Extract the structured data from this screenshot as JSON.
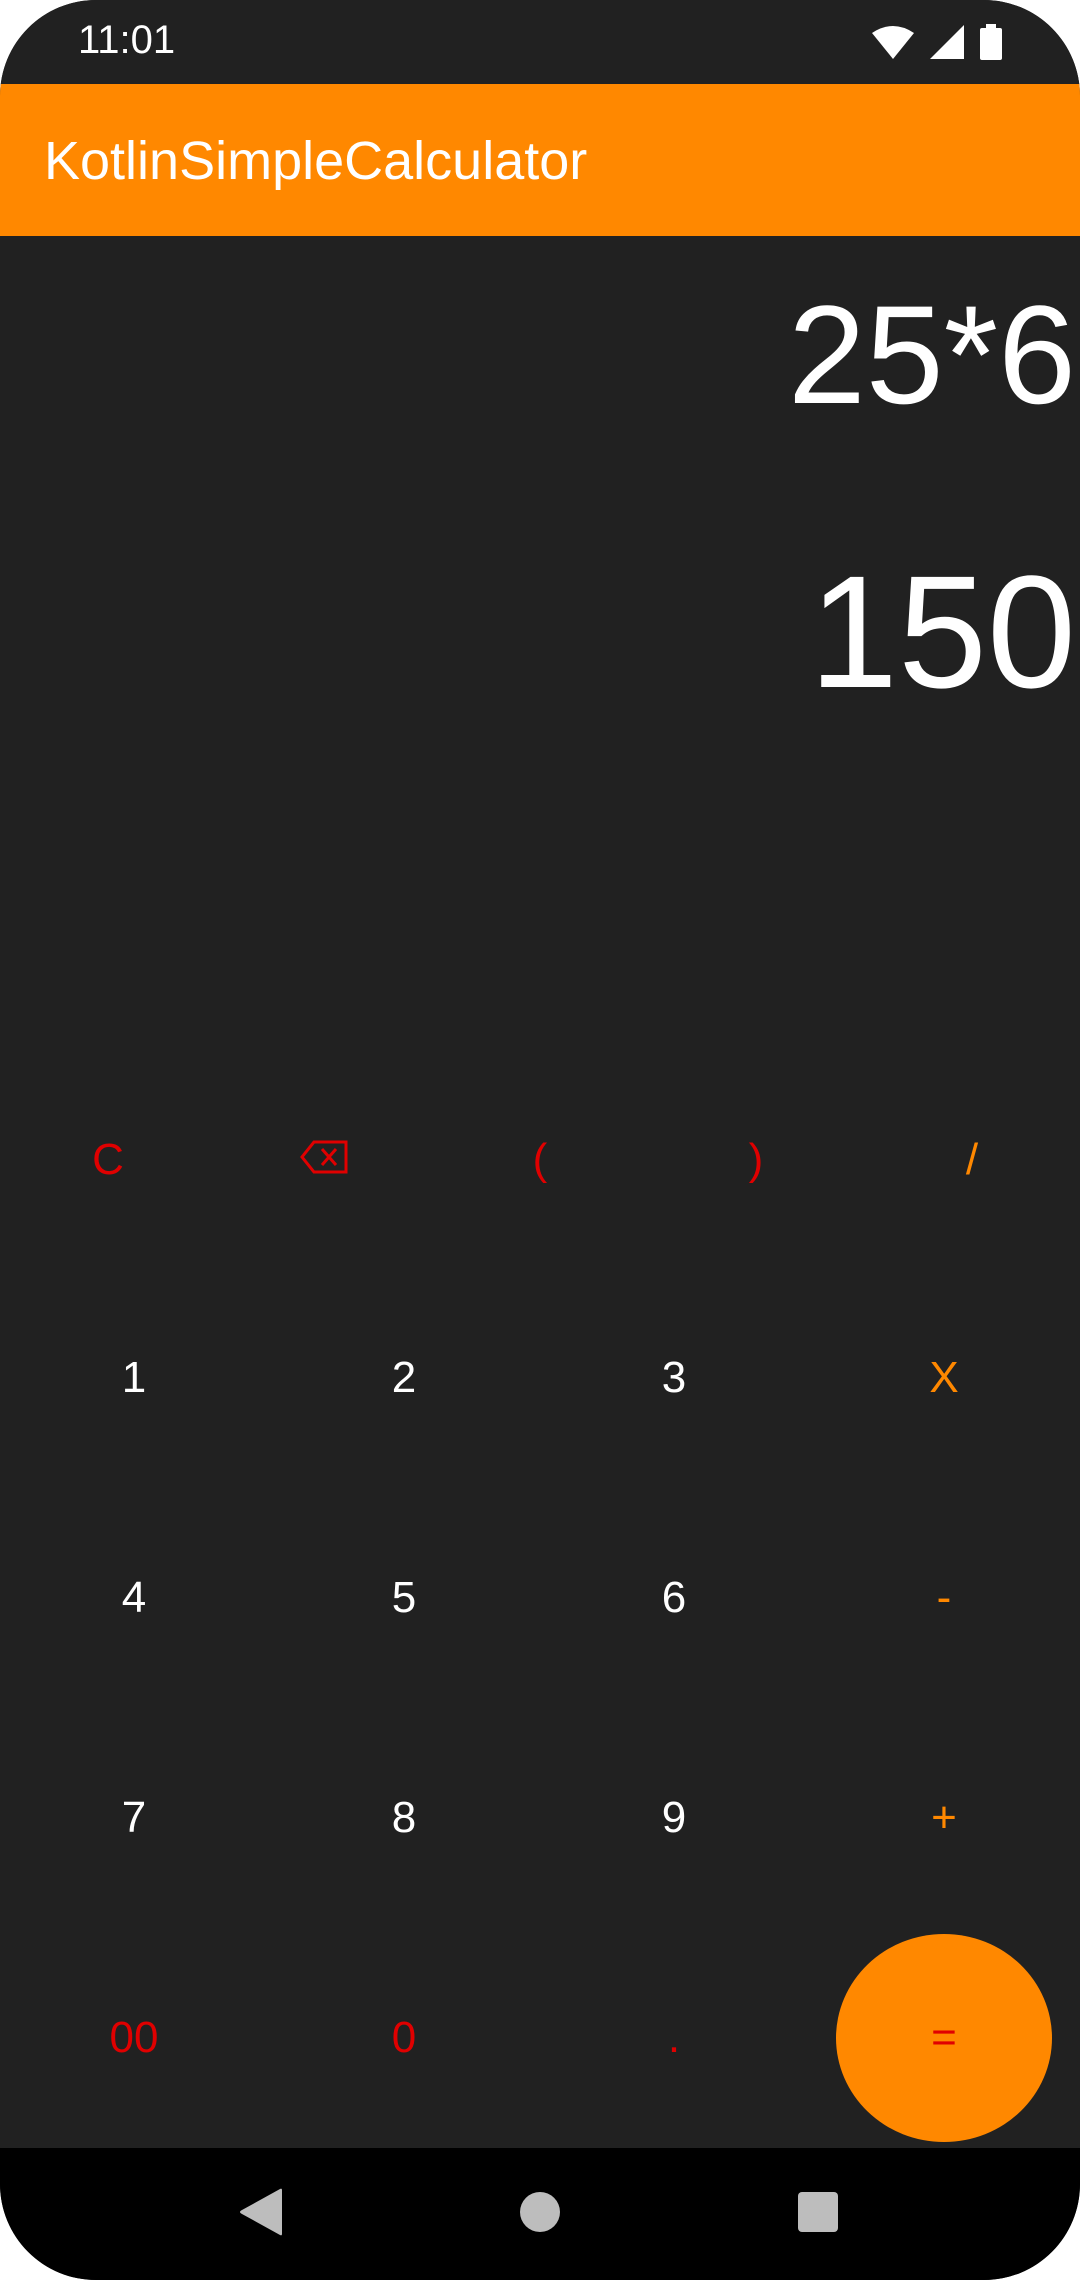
{
  "status_bar": {
    "time": "11:01",
    "icons": [
      "wifi-icon",
      "signal-icon",
      "battery-icon"
    ]
  },
  "app_bar": {
    "title": "KotlinSimpleCalculator",
    "color": "#ff8800"
  },
  "display": {
    "expression": "25*6",
    "result": "150"
  },
  "keypad": {
    "row1": {
      "clear": "C",
      "open_paren": "(",
      "close_paren": ")",
      "divide": "/"
    },
    "row2": {
      "one": "1",
      "two": "2",
      "three": "3",
      "multiply": "X"
    },
    "row3": {
      "four": "4",
      "five": "5",
      "six": "6",
      "minus": "-"
    },
    "row4": {
      "seven": "7",
      "eight": "8",
      "nine": "9",
      "plus": "+"
    },
    "row5": {
      "double_zero": "00",
      "zero": "0",
      "dot": ".",
      "equals": "="
    }
  },
  "colors": {
    "background": "#212121",
    "accent": "#ff8800",
    "function_red": "#e00000"
  },
  "nav_bar": {
    "icons": [
      "back-icon",
      "home-icon",
      "recents-icon"
    ]
  }
}
